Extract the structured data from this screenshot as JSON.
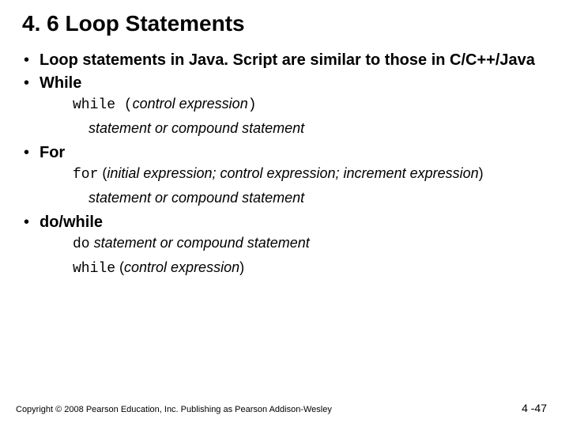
{
  "title": "4. 6 Loop Statements",
  "bullets": {
    "intro": "Loop statements in Java. Script are similar to those in C/C++/Java",
    "while_label": "While",
    "while_kw": "while (",
    "while_ctrl": "control expression",
    "while_close": ")",
    "while_body": "statement or compound statement",
    "for_label": "For",
    "for_kw": "for",
    "for_open": " (",
    "for_args": "initial expression; control expression; increment expression",
    "for_close": ")",
    "for_body": "statement or compound statement",
    "dowhile_label": "do/while",
    "do_kw": "do",
    "do_body": " statement or compound statement",
    "do_while_kw": "while",
    "do_while_open": " (",
    "do_while_ctrl": "control expression",
    "do_while_close": ")"
  },
  "footer": {
    "copyright": "Copyright © 2008 Pearson Education, Inc. Publishing as Pearson Addison-Wesley",
    "pagenum": "4 -47"
  }
}
